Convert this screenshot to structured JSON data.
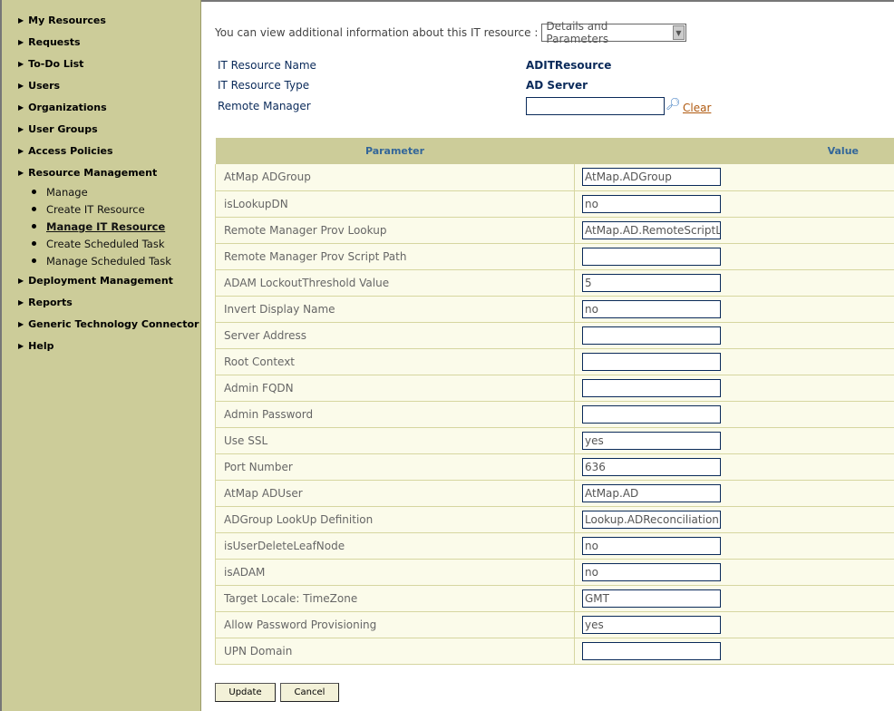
{
  "sidebar": {
    "items": [
      {
        "label": "My Resources"
      },
      {
        "label": "Requests"
      },
      {
        "label": "To-Do List"
      },
      {
        "label": "Users"
      },
      {
        "label": "Organizations"
      },
      {
        "label": "User Groups"
      },
      {
        "label": "Access Policies"
      },
      {
        "label": "Resource Management",
        "children": [
          {
            "label": "Manage"
          },
          {
            "label": "Create IT Resource"
          },
          {
            "label": "Manage IT Resource",
            "active": true
          },
          {
            "label": "Create Scheduled Task"
          },
          {
            "label": "Manage Scheduled Task"
          }
        ]
      },
      {
        "label": "Deployment Management"
      },
      {
        "label": "Reports"
      },
      {
        "label": "Generic Technology Connector"
      },
      {
        "label": "Help"
      }
    ]
  },
  "info": {
    "text": "You can view additional information about this IT resource :",
    "select_value": "Details and Parameters"
  },
  "details": {
    "name_label": "IT Resource Name",
    "name_value": "ADITResource",
    "type_label": "IT Resource Type",
    "type_value": "AD Server",
    "remote_label": "Remote Manager",
    "remote_value": "",
    "clear_label": "Clear"
  },
  "table": {
    "headers": [
      "Parameter",
      "Value"
    ],
    "rows": [
      {
        "param": "AtMap ADGroup",
        "value": "AtMap.ADGroup"
      },
      {
        "param": "isLookupDN",
        "value": "no"
      },
      {
        "param": "Remote Manager Prov Lookup",
        "value": "AtMap.AD.RemoteScriptLookup"
      },
      {
        "param": "Remote Manager Prov Script Path",
        "value": ""
      },
      {
        "param": "ADAM LockoutThreshold Value",
        "value": "5"
      },
      {
        "param": "Invert Display Name",
        "value": "no"
      },
      {
        "param": "Server Address",
        "value": ""
      },
      {
        "param": "Root Context",
        "value": ""
      },
      {
        "param": "Admin FQDN",
        "value": ""
      },
      {
        "param": "Admin Password",
        "value": ""
      },
      {
        "param": "Use SSL",
        "value": "yes"
      },
      {
        "param": "Port Number",
        "value": "636"
      },
      {
        "param": "AtMap ADUser",
        "value": "AtMap.AD"
      },
      {
        "param": "ADGroup LookUp Definition",
        "value": "Lookup.ADReconciliation.GroupLookup"
      },
      {
        "param": "isUserDeleteLeafNode",
        "value": "no"
      },
      {
        "param": "isADAM",
        "value": "no"
      },
      {
        "param": "Target Locale: TimeZone",
        "value": "GMT"
      },
      {
        "param": "Allow Password Provisioning",
        "value": "yes"
      },
      {
        "param": "UPN Domain",
        "value": ""
      }
    ]
  },
  "buttons": {
    "update": "Update",
    "cancel": "Cancel"
  }
}
